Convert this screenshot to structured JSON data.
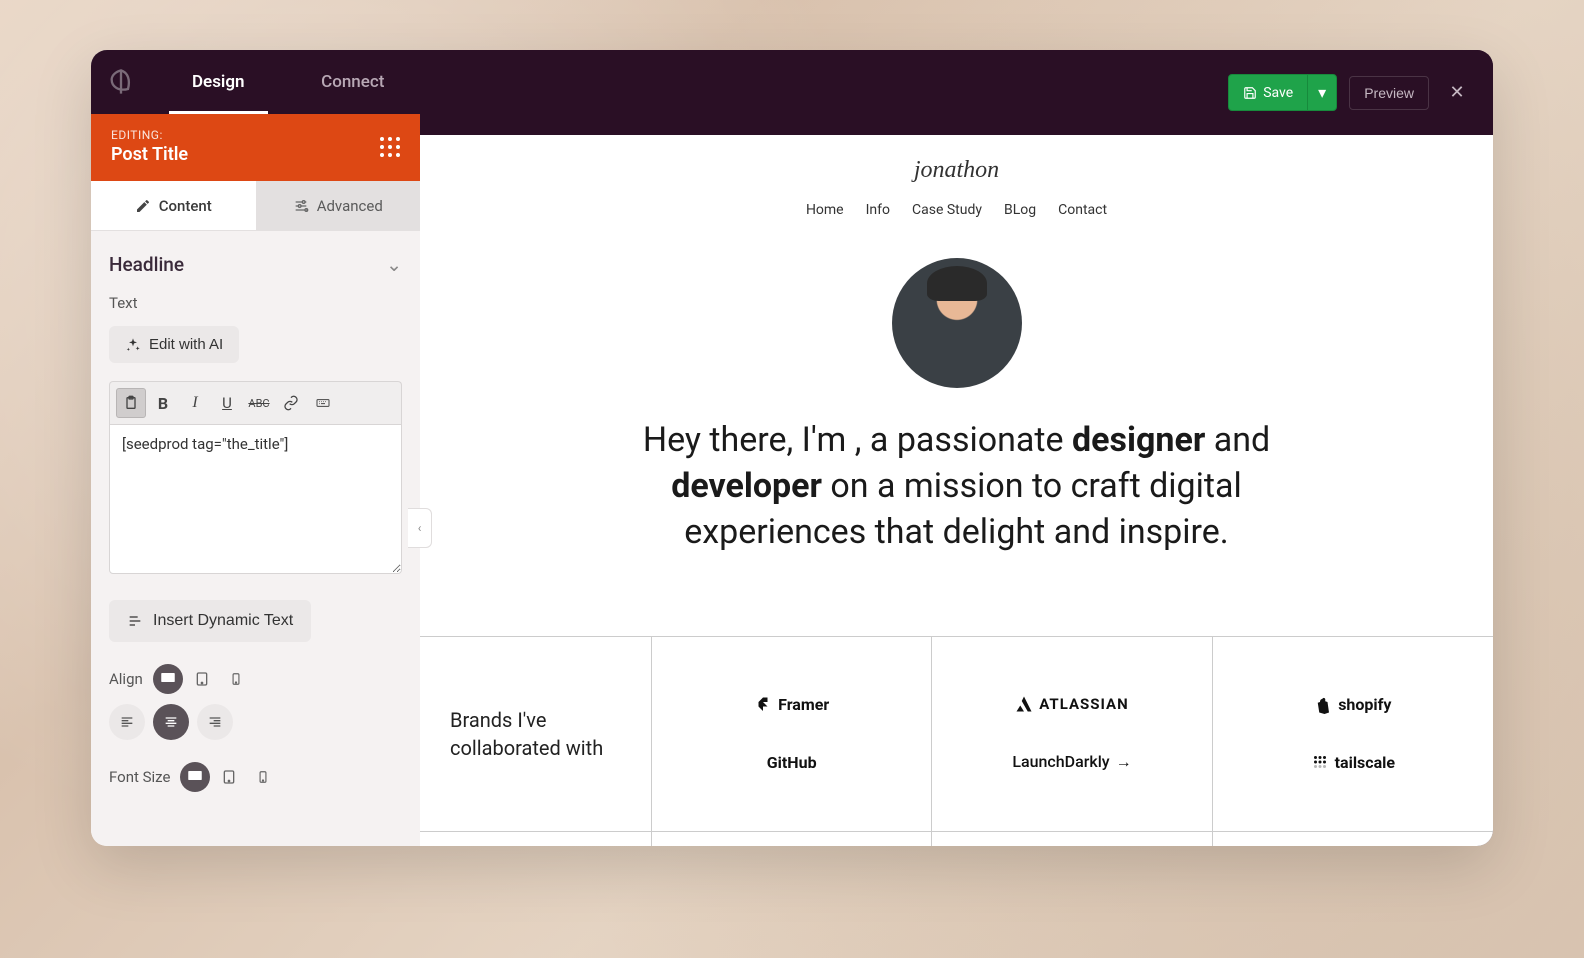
{
  "sidebar": {
    "tabs": {
      "design": "Design",
      "connect": "Connect"
    },
    "editing_label": "EDITING:",
    "editing_title": "Post Title",
    "subtabs": {
      "content": "Content",
      "advanced": "Advanced"
    },
    "section": "Headline",
    "text_label": "Text",
    "ai_button": "Edit with AI",
    "textarea_value": "[seedprod tag=\"the_title\"]",
    "dynamic_button": "Insert Dynamic Text",
    "align_label": "Align",
    "fontsize_label": "Font Size"
  },
  "topbar": {
    "save": "Save",
    "preview": "Preview"
  },
  "site": {
    "name": "jonathon",
    "nav": [
      "Home",
      "Info",
      "Case Study",
      "BLog",
      "Contact"
    ],
    "hero_pre": "Hey there, I'm , a passionate ",
    "hero_b1": "designer",
    "hero_mid": " and ",
    "hero_b2": "developer",
    "hero_post": " on a mission to craft digital experiences that delight and inspire.",
    "brands_label": "Brands I've collaborated with",
    "brands": {
      "framer": "Framer",
      "github": "GitHub",
      "atlassian": "ATLASSIAN",
      "launchdarkly": "LaunchDarkly",
      "shopify": "shopify",
      "tailscale": "tailscale"
    }
  }
}
